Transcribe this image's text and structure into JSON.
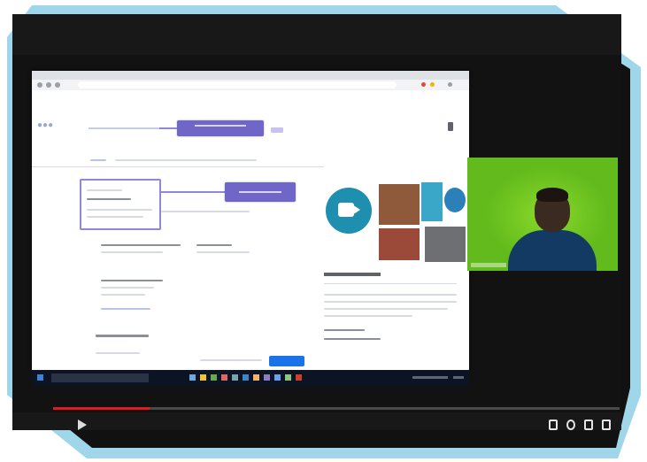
{
  "video": {
    "title": "",
    "time": "",
    "progress_fraction": 0.17
  },
  "icons": {
    "meet": "google-meet-icon",
    "play": "play-icon",
    "subtitles": "subtitles-icon",
    "settings": "gear-icon",
    "miniplayer": "miniplayer-icon",
    "fullscreen": "fullscreen-icon"
  },
  "colors": {
    "frame": "#9fd6ea",
    "callout": "#7066c8",
    "meet_teal": "#1f8fb0",
    "webcam_green": "#62ba1c",
    "progress_red": "#e41b1b",
    "search_button_blue": "#1a73e8"
  }
}
